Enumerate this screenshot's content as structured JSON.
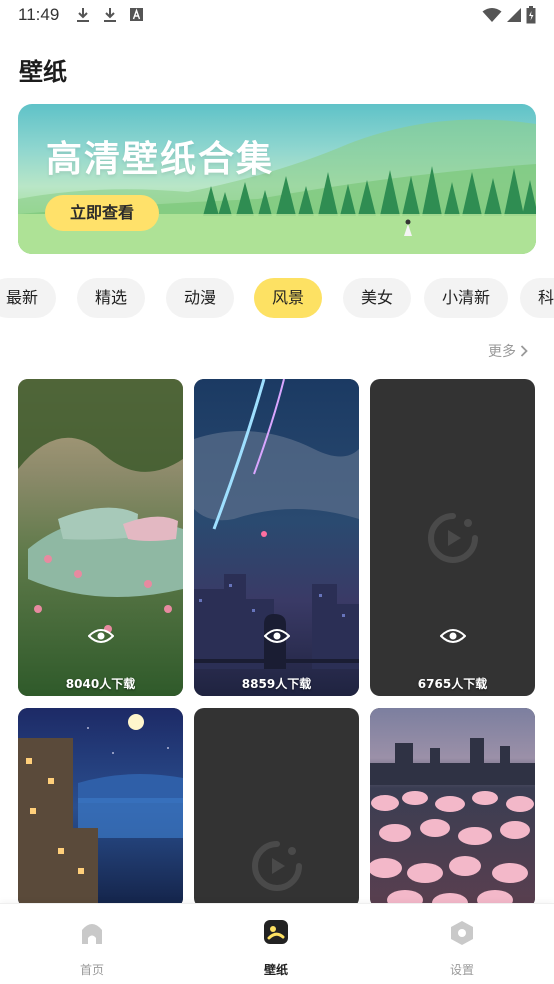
{
  "status_bar": {
    "time": "11:49"
  },
  "page_title": "壁纸",
  "banner": {
    "title": "高清壁纸合集",
    "button_label": "立即查看"
  },
  "categories": [
    "最新",
    "精选",
    "动漫",
    "风景",
    "美女",
    "小清新",
    "科"
  ],
  "active_category": "风景",
  "more_label": "更多",
  "cards": [
    {
      "downloads": "8040人下载",
      "kind": "bed-meadow"
    },
    {
      "downloads": "8859人下载",
      "kind": "anime-city-night"
    },
    {
      "downloads": "6765人下载",
      "kind": "placeholder"
    },
    {
      "downloads": "",
      "kind": "coastal-town-night"
    },
    {
      "downloads": "",
      "kind": "placeholder"
    },
    {
      "downloads": "",
      "kind": "pink-flowers"
    }
  ],
  "bottom_nav": [
    {
      "label": "首页",
      "icon": "home-icon",
      "active": false
    },
    {
      "label": "壁纸",
      "icon": "wallpaper-icon",
      "active": true
    },
    {
      "label": "设置",
      "icon": "settings-icon",
      "active": false
    }
  ],
  "colors": {
    "accent": "#fde163",
    "placeholder": "#333333"
  }
}
